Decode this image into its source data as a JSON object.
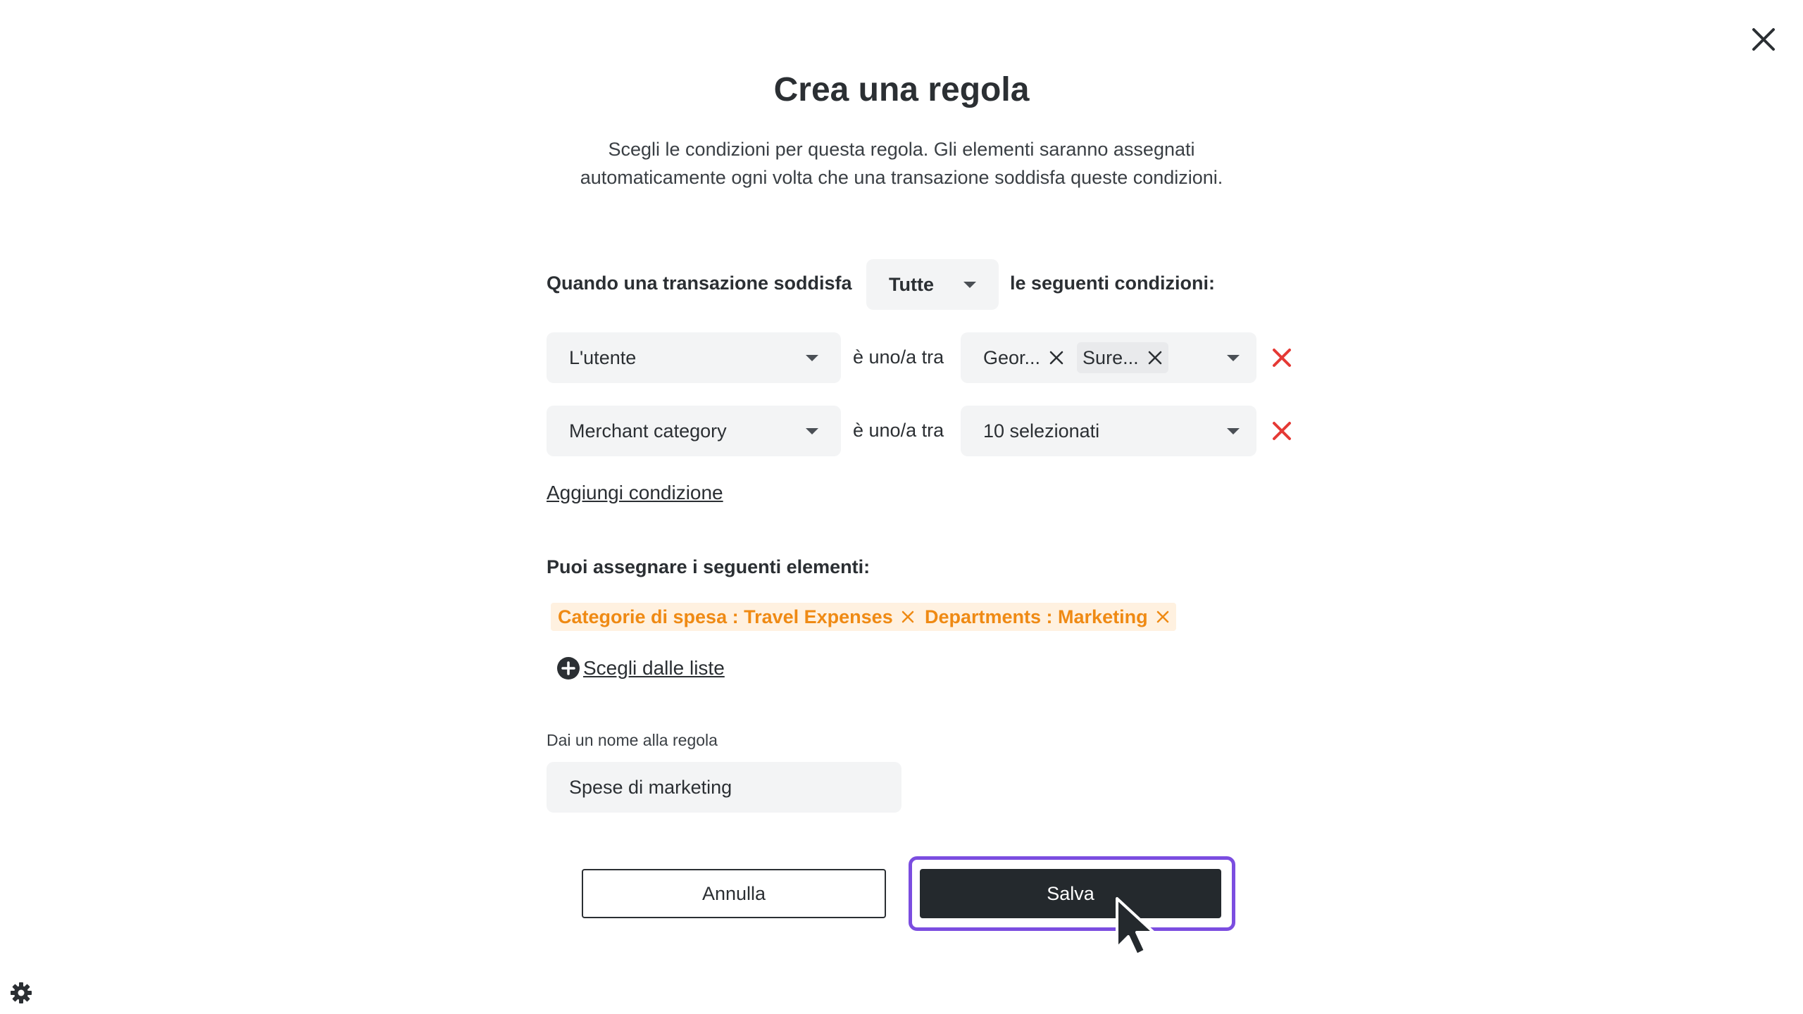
{
  "dialog": {
    "title": "Crea una regola",
    "subtitle_line1": "Scegli le condizioni per questa regola. Gli elementi saranno assegnati",
    "subtitle_line2": "automaticamente ogni volta che una transazione soddisfa queste condizioni."
  },
  "conditions": {
    "prefix": "Quando una transazione soddisfa",
    "match_value": "Tutte",
    "suffix": "le seguenti condizioni:",
    "rows": [
      {
        "field": "L'utente",
        "operator": "è uno/a tra",
        "chips": [
          "Geor...",
          "Sure..."
        ]
      },
      {
        "field": "Merchant category",
        "operator": "è uno/a tra",
        "value": "10 selezionati"
      }
    ],
    "add_label": "Aggiungi condizione"
  },
  "assign": {
    "title": "Puoi assegnare i seguenti elementi:",
    "tags": [
      "Categorie di spesa : Travel Expenses",
      "Departments : Marketing"
    ],
    "choose_label": "Scegli dalle liste"
  },
  "name": {
    "label": "Dai un nome alla regola",
    "value": "Spese di marketing"
  },
  "buttons": {
    "cancel": "Annulla",
    "save": "Salva"
  },
  "colors": {
    "accent_focus": "#7b4de0",
    "delete": "#e53935",
    "tag_text": "#ef8a14",
    "tag_bg": "#fff1e0",
    "primary_btn": "#24292d"
  }
}
